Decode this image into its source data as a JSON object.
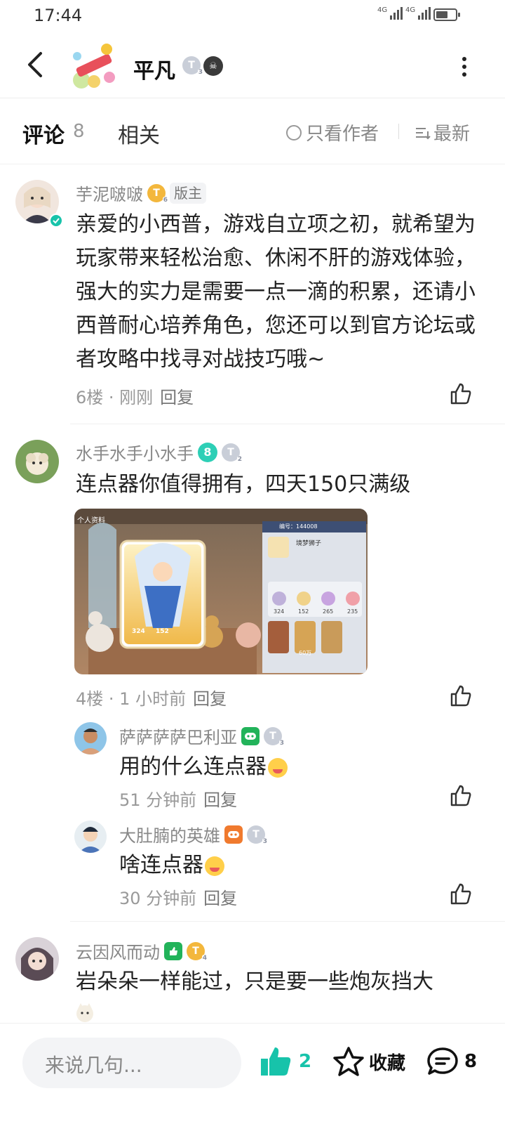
{
  "status_bar": {
    "time": "17:44",
    "network_1": "4G",
    "network_2": "4G",
    "battery_level": 0.6
  },
  "header": {
    "title": "平凡",
    "level_badge": "T",
    "level_sub": "3",
    "skull_badge": "☠"
  },
  "tabs": {
    "comments_label": "评论",
    "comments_count": "8",
    "related_label": "相关",
    "author_only_label": "只看作者",
    "sort_label": "最新"
  },
  "comments": [
    {
      "username": "芋泥啵啵",
      "level": "T",
      "level_sub": "6",
      "tag": "版主",
      "text": "亲爱的小西普，游戏自立项之初，就希望为玩家带来轻松治愈、休闲不肝的游戏体验，强大的实力是需要一点一滴的积累，还请小西普耐心培养角色，您还可以到官方论坛或者攻略中找寻对战技巧哦~",
      "floor": "6楼",
      "time": "刚刚",
      "reply_label": "回复"
    },
    {
      "username": "水手水手小水手",
      "badge_8": "8",
      "level": "T",
      "level_sub": "2",
      "text": "连点器你值得拥有，四天150只满级",
      "floor": "4楼",
      "time": "1 小时前",
      "reply_label": "回复",
      "image": {
        "corner_label": "个人资料",
        "id_label": "编号：144008",
        "char_name": "境梦狮子",
        "stat_1": "324",
        "stat_2": "152",
        "stat_3": "265",
        "stat_4": "235",
        "card_stat_1": "324",
        "card_stat_2": "152",
        "coin": "60万"
      },
      "replies": [
        {
          "username": "萨萨萨萨巴利亚",
          "level": "T",
          "level_sub": "3",
          "text": "用的什么连点器",
          "time": "51 分钟前",
          "reply_label": "回复"
        },
        {
          "username": "大肚腩的英雄",
          "level": "T",
          "level_sub": "3",
          "text": "啥连点器",
          "time": "30 分钟前",
          "reply_label": "回复"
        }
      ]
    },
    {
      "username": "云因风而动",
      "level": "T",
      "level_sub": "4",
      "text": "岩朵朵一样能过，只是要一些炮灰挡大"
    }
  ],
  "bottom_bar": {
    "input_placeholder": "来说几句...",
    "like_count": "2",
    "favorite_label": "收藏",
    "comment_count": "8"
  },
  "colors": {
    "accent": "#17c3aa",
    "tab_underline": "#2ed3b7",
    "gold_badge": "#f3b73c"
  }
}
